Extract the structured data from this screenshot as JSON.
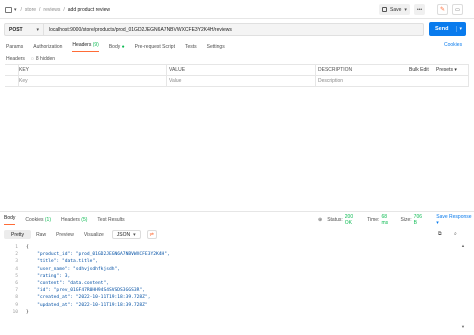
{
  "breadcrumb": [
    "store",
    "reviews",
    "add product review"
  ],
  "toolbar": {
    "save_label": "Save"
  },
  "request": {
    "method": "POST",
    "url": "localhost:9000/store/products/prod_01GD2JEGN6A7NBVWXCFE3Y2K4H/reviews",
    "send_label": "Send",
    "cookies_label": "Cookies"
  },
  "request_tabs": {
    "params": "Params",
    "authorization": "Authorization",
    "headers": "Headers",
    "headers_count": "(9)",
    "body": "Body",
    "pre_request": "Pre-request Script",
    "tests": "Tests",
    "settings": "Settings"
  },
  "headers_panel": {
    "label": "Headers",
    "hidden": "8 hidden",
    "col_key": "KEY",
    "col_value": "VALUE",
    "col_description": "DESCRIPTION",
    "bulk_edit": "Bulk Edit",
    "presets": "Presets",
    "placeholder_key": "Key",
    "placeholder_value": "Value",
    "placeholder_description": "Description"
  },
  "response_tabs": {
    "body": "Body",
    "cookies": "Cookies",
    "cookies_count": "(1)",
    "headers": "Headers",
    "headers_count": "(5)",
    "test_results": "Test Results"
  },
  "response_status": {
    "status_label": "Status:",
    "status_value": "200 OK",
    "time_label": "Time:",
    "time_value": "68 ms",
    "size_label": "Size:",
    "size_value": "706 B",
    "save_response": "Save Response"
  },
  "response_view": {
    "pretty": "Pretty",
    "raw": "Raw",
    "preview": "Preview",
    "visualize": "Visualize",
    "format": "JSON"
  },
  "response_lines": [
    {
      "n": "1",
      "text": "{"
    },
    {
      "n": "2",
      "text": "    \"product_id\": \"prod_01GD2JEGN6A7NBVWXCFE3Y2K4H\","
    },
    {
      "n": "3",
      "text": "    \"title\": \"data.title\","
    },
    {
      "n": "4",
      "text": "    \"user_name\": \"sdhvjsdhfkjsdh\","
    },
    {
      "n": "5",
      "text": "    \"rating\": 3,"
    },
    {
      "n": "6",
      "text": "    \"content\": \"data.content\","
    },
    {
      "n": "7",
      "text": "    \"id\": \"prev_01GF47R0HH94S4SVSDS3GGS3R\","
    },
    {
      "n": "8",
      "text": "    \"created_at\": \"2022-10-11T19:18:39.728Z\","
    },
    {
      "n": "9",
      "text": "    \"updated_at\": \"2022-10-11T19:18:39.728Z\""
    },
    {
      "n": "10",
      "text": "}"
    }
  ],
  "colors": {
    "accent": "#ff6c37",
    "send": "#097bed",
    "status_ok": "#0cbb52"
  }
}
